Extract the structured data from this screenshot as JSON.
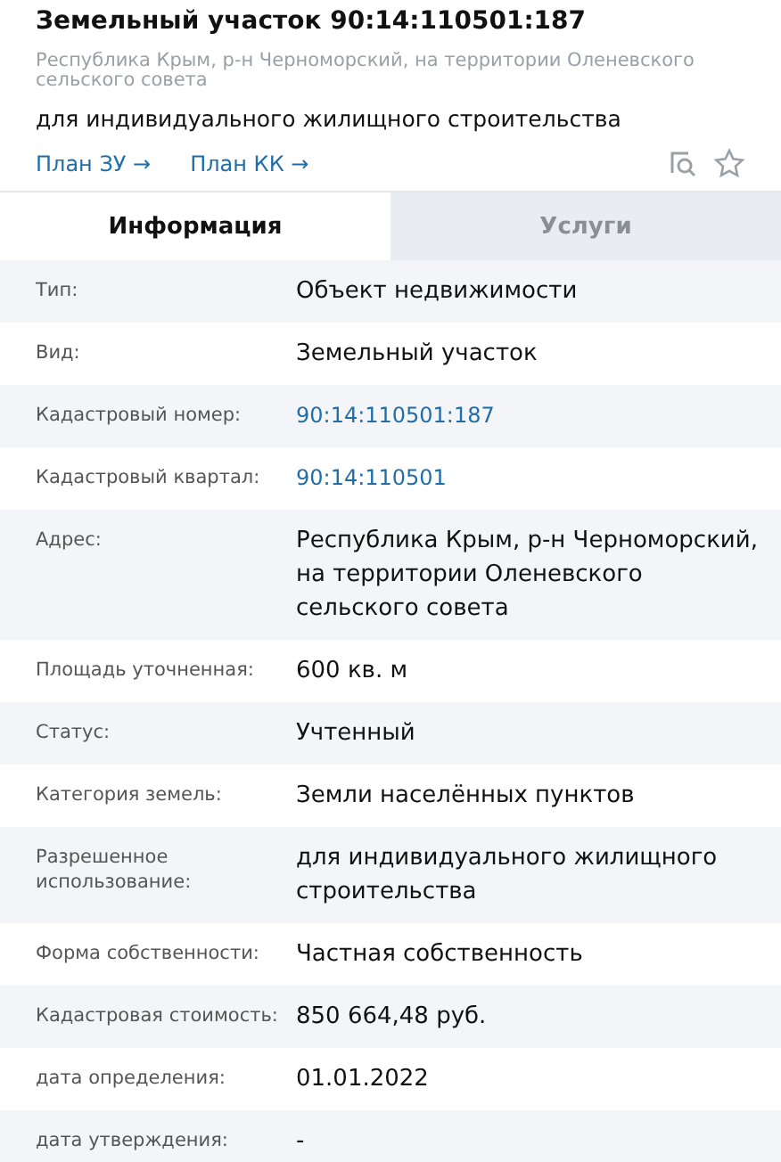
{
  "header": {
    "title": "Земельный участок 90:14:110501:187",
    "address": "Республика Крым, р-н Черноморский, на территории Оленевского сельского совета",
    "purpose": "для индивидуального жилищного строительства",
    "links": [
      "План ЗУ →",
      "План КК →"
    ]
  },
  "tabs": [
    {
      "label": "Информация",
      "selected": true
    },
    {
      "label": "Услуги",
      "selected": false
    }
  ],
  "rows": [
    {
      "label": "Тип:",
      "value": "Объект недвижимости",
      "kind": "text"
    },
    {
      "label": "Вид:",
      "value": "Земельный участок",
      "kind": "text"
    },
    {
      "label": "Кадастровый номер:",
      "value": "90:14:110501:187",
      "kind": "link"
    },
    {
      "label": "Кадастровый квартал:",
      "value": "90:14:110501",
      "kind": "link"
    },
    {
      "label": "Адрес:",
      "value": "Республика Крым, р-н Черноморский, на территории Оленевского сельского совета",
      "kind": "text"
    },
    {
      "label": "Площадь уточненная:",
      "value": "600 кв. м",
      "kind": "text"
    },
    {
      "label": "Статус:",
      "value": "Учтенный",
      "kind": "text"
    },
    {
      "label": "Категория земель:",
      "value": "Земли населённых пунктов",
      "kind": "text"
    },
    {
      "label": "Разрешенное использование:",
      "value": "для индивидуального жилищного строительства",
      "kind": "text"
    },
    {
      "label": "Форма собственности:",
      "value": "Частная собственность",
      "kind": "text"
    },
    {
      "label": "Кадастровая стоимость:",
      "value": "850 664,48 руб.",
      "kind": "text"
    },
    {
      "label": "дата определения:",
      "value": "01.01.2022",
      "kind": "text"
    },
    {
      "label": "дата утверждения:",
      "value": "-",
      "kind": "text"
    }
  ]
}
